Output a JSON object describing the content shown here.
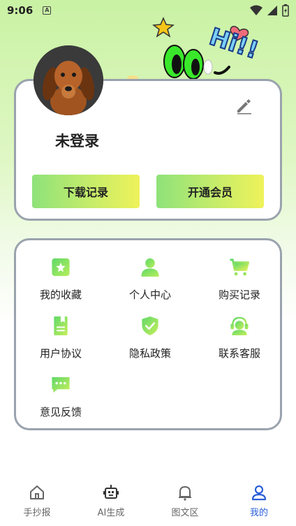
{
  "status": {
    "time": "9:06",
    "indicator": "A"
  },
  "decoration": {
    "hi_text": "Hi!!"
  },
  "profile": {
    "username": "未登录",
    "edit_icon": "pencil-icon",
    "buttons": {
      "download": "下载记录",
      "vip": "开通会员"
    }
  },
  "menu": {
    "items": [
      {
        "label": "我的收藏",
        "icon": "star-bookmark-icon"
      },
      {
        "label": "个人中心",
        "icon": "person-icon"
      },
      {
        "label": "购买记录",
        "icon": "cart-icon"
      },
      {
        "label": "用户协议",
        "icon": "document-icon"
      },
      {
        "label": "隐私政策",
        "icon": "shield-check-icon"
      },
      {
        "label": "联系客服",
        "icon": "headset-icon"
      },
      {
        "label": "意见反馈",
        "icon": "chat-bubble-icon"
      }
    ]
  },
  "nav": {
    "items": [
      {
        "label": "手抄报",
        "icon": "home-icon"
      },
      {
        "label": "AI生成",
        "icon": "robot-icon"
      },
      {
        "label": "图文区",
        "icon": "bell-icon"
      },
      {
        "label": "我的",
        "icon": "user-icon"
      }
    ],
    "active_index": 3
  },
  "colors": {
    "accent_green": "#8ee27a",
    "accent_yellow": "#eef25a",
    "nav_active": "#2b5fd9",
    "card_border": "#9aa3ad"
  }
}
